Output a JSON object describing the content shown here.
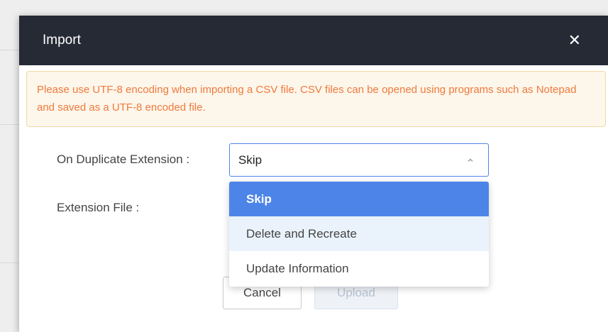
{
  "dialog": {
    "title": "Import",
    "close_icon": "close-icon"
  },
  "notice": {
    "text": "Please use UTF-8 encoding when importing a CSV file. CSV files can be opened using programs such as Notepad and saved as a UTF-8 encoded file."
  },
  "form": {
    "duplicate_label": "On Duplicate Extension :",
    "duplicate_value": "Skip",
    "file_label": "Extension File :"
  },
  "dropdown": {
    "options": [
      "Skip",
      "Delete and Recreate",
      "Update Information"
    ],
    "selected": "Skip",
    "hovered": "Delete and Recreate"
  },
  "buttons": {
    "cancel": "Cancel",
    "upload": "Upload"
  },
  "colors": {
    "header_bg": "#262a35",
    "accent": "#4d84e8",
    "notice_text": "#f07a3e",
    "notice_bg": "#fdf6ea"
  }
}
